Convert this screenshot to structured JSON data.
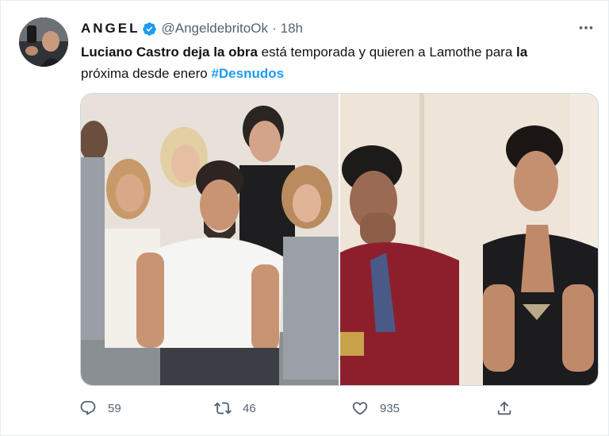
{
  "author": {
    "name": "ANGEL",
    "handle": "@AngeldebritoOk",
    "time": "18h",
    "dot": "·",
    "verified_color": "#1d9bf0"
  },
  "tweet": {
    "t1": "Luciano Castro deja la obra",
    "t2": " está temporada y quieren a Lamothe para ",
    "t3": "la",
    "t4": "próxima desde enero ",
    "hashtag": "#Desnudos"
  },
  "icons": {
    "reply": "reply-icon",
    "retweet": "retweet-icon",
    "like": "heart-icon",
    "share": "share-icon",
    "more": "more-icon"
  },
  "metrics": {
    "replies": "59",
    "retweets": "46",
    "likes": "935"
  },
  "colors": {
    "accent": "#1d9bf0",
    "muted": "#536471"
  }
}
